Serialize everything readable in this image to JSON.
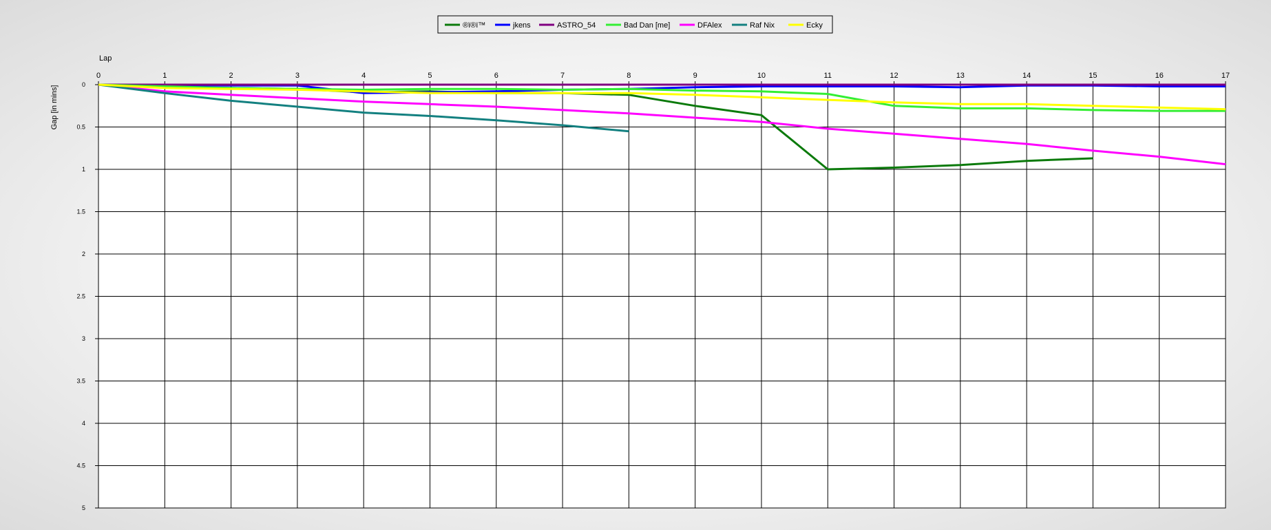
{
  "chart_data": {
    "type": "line",
    "xlabel": "Lap",
    "ylabel": "Gap [in mins]",
    "xlim": [
      0,
      17
    ],
    "ylim": [
      0,
      5
    ],
    "y_inverted": true,
    "grid": true,
    "legend_position": "top-center",
    "x_ticks": [
      "0",
      "1",
      "2",
      "3",
      "4",
      "5",
      "6",
      "7",
      "8",
      "9",
      "10",
      "11",
      "12",
      "13",
      "14",
      "15",
      "16",
      "17"
    ],
    "y_ticks": [
      "0",
      "0.5",
      "1",
      "1.5",
      "2",
      "2.5",
      "3",
      "3.5",
      "4",
      "4.5",
      "5"
    ],
    "series": [
      {
        "name": "®ï®ï™",
        "color": "#0b7a0b",
        "x": [
          0,
          1,
          2,
          3,
          4,
          5,
          6,
          7,
          8,
          9,
          10,
          11,
          12,
          13,
          14,
          15
        ],
        "y": [
          0,
          0.03,
          0.04,
          0.05,
          0.09,
          0.08,
          0.1,
          0.1,
          0.12,
          0.25,
          0.36,
          1.0,
          0.98,
          0.95,
          0.9,
          0.87
        ]
      },
      {
        "name": "jkens",
        "color": "#0000ff",
        "x": [
          0,
          1,
          2,
          3,
          4,
          5,
          6,
          7,
          8,
          9,
          10,
          11,
          12,
          13,
          14,
          15,
          16,
          17
        ],
        "y": [
          0,
          0.01,
          0.01,
          0.01,
          0.1,
          0.09,
          0.08,
          0.06,
          0.05,
          0.03,
          0.02,
          0.02,
          0.02,
          0.03,
          0.01,
          0.01,
          0.02,
          0.02
        ]
      },
      {
        "name": "ASTRO_54",
        "color": "#800080",
        "x": [
          0,
          1,
          2,
          3,
          4,
          5,
          6,
          7,
          8,
          9,
          10,
          11,
          12,
          13,
          14,
          15,
          16,
          17
        ],
        "y": [
          0,
          0,
          0,
          0,
          0,
          0,
          0,
          0,
          0,
          0,
          0,
          0,
          0,
          0,
          0,
          0,
          0,
          0
        ]
      },
      {
        "name": "Bad Dan [me]",
        "color": "#33ee33",
        "x": [
          0,
          1,
          2,
          3,
          4,
          5,
          6,
          7,
          8,
          9,
          10,
          11,
          12,
          13,
          14,
          15,
          16,
          17
        ],
        "y": [
          0,
          0.02,
          0.04,
          0.05,
          0.06,
          0.05,
          0.05,
          0.06,
          0.05,
          0.07,
          0.08,
          0.11,
          0.25,
          0.28,
          0.28,
          0.3,
          0.31,
          0.31
        ]
      },
      {
        "name": "DFAlex",
        "color": "#ff00ff",
        "x": [
          0,
          1,
          2,
          3,
          4,
          5,
          6,
          7,
          8,
          9,
          10,
          11,
          12,
          13,
          14,
          15,
          16,
          17
        ],
        "y": [
          0,
          0.08,
          0.12,
          0.16,
          0.2,
          0.23,
          0.26,
          0.3,
          0.34,
          0.39,
          0.44,
          0.52,
          0.58,
          0.64,
          0.7,
          0.78,
          0.85,
          0.94
        ]
      },
      {
        "name": "Raf Nix",
        "color": "#138080",
        "x": [
          0,
          1,
          2,
          3,
          4,
          5,
          6,
          7,
          8
        ],
        "y": [
          0,
          0.1,
          0.19,
          0.26,
          0.33,
          0.37,
          0.42,
          0.48,
          0.55
        ]
      },
      {
        "name": "Ecky",
        "color": "#ffff00",
        "x": [
          0,
          1,
          2,
          3,
          4,
          5,
          6,
          7,
          8,
          9,
          10,
          11,
          12,
          13,
          14,
          15,
          16,
          17
        ],
        "y": [
          0,
          0.04,
          0.05,
          0.06,
          0.08,
          0.1,
          0.1,
          0.1,
          0.1,
          0.12,
          0.15,
          0.18,
          0.21,
          0.23,
          0.23,
          0.25,
          0.27,
          0.29
        ]
      }
    ]
  }
}
